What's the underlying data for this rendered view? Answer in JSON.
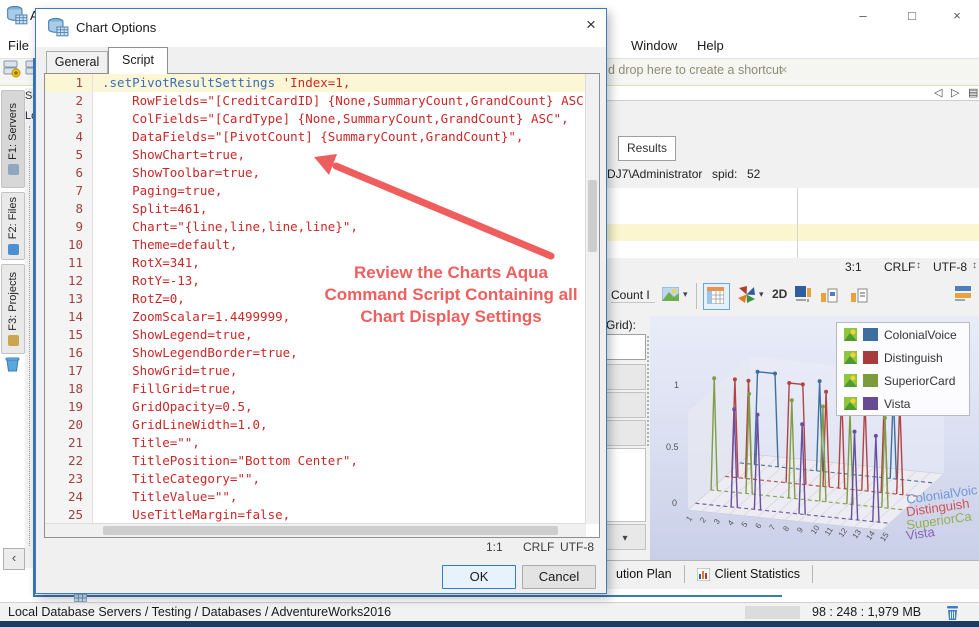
{
  "glyphs": {
    "close": "×",
    "minimize": "–",
    "maximize": "□",
    "caret": "▾",
    "back": "◁",
    "forward": "▷",
    "list": "▤",
    "updown": "↕",
    "collapse": "‹"
  },
  "window": {
    "title_partial": "A",
    "menus": {
      "file": "File",
      "window": "Window",
      "help": "Help"
    },
    "shortcut_hint": "d drop here to create a shortcut",
    "sidebar_tabs": [
      {
        "label": "F1: Servers"
      },
      {
        "label": "F2: Files"
      },
      {
        "label": "F3: Projects"
      }
    ],
    "servers_panel": {
      "header_partial": "Se",
      "tree_item_partial": "Lo"
    },
    "status": {
      "breadcrumb": "Local Database Servers / Testing / Databases / AdventureWorks2016",
      "memory": "98 : 248 : 1,979 MB"
    }
  },
  "dialog": {
    "title": "Chart Options",
    "tabs": {
      "general": "General",
      "script": "Script"
    },
    "code_lines": [
      {
        "num": "1",
        "kw": ".setPivotResultSettings",
        "text": " 'Index=1,",
        "current": true
      },
      {
        "num": "2",
        "kw": "",
        "text": "    RowFields=\"[CreditCardID] {None,SummaryCount,GrandCount} ASC\","
      },
      {
        "num": "3",
        "kw": "",
        "text": "    ColFields=\"[CardType] {None,SummaryCount,GrandCount} ASC\","
      },
      {
        "num": "4",
        "kw": "",
        "text": "    DataFields=\"[PivotCount] {SummaryCount,GrandCount}\","
      },
      {
        "num": "5",
        "kw": "",
        "text": "    ShowChart=true,"
      },
      {
        "num": "6",
        "kw": "",
        "text": "    ShowToolbar=true,"
      },
      {
        "num": "7",
        "kw": "",
        "text": "    Paging=true,"
      },
      {
        "num": "8",
        "kw": "",
        "text": "    Split=461,"
      },
      {
        "num": "9",
        "kw": "",
        "text": "    Chart=\"{line,line,line,line}\","
      },
      {
        "num": "10",
        "kw": "",
        "text": "    Theme=default,"
      },
      {
        "num": "11",
        "kw": "",
        "text": "    RotX=341,"
      },
      {
        "num": "12",
        "kw": "",
        "text": "    RotY=-13,"
      },
      {
        "num": "13",
        "kw": "",
        "text": "    RotZ=0,"
      },
      {
        "num": "14",
        "kw": "",
        "text": "    ZoomScalar=1.4499999,"
      },
      {
        "num": "15",
        "kw": "",
        "text": "    ShowLegend=true,"
      },
      {
        "num": "16",
        "kw": "",
        "text": "    ShowLegendBorder=true,"
      },
      {
        "num": "17",
        "kw": "",
        "text": "    ShowGrid=true,"
      },
      {
        "num": "18",
        "kw": "",
        "text": "    FillGrid=true,"
      },
      {
        "num": "19",
        "kw": "",
        "text": "    GridOpacity=0.5,"
      },
      {
        "num": "20",
        "kw": "",
        "text": "    GridLineWidth=1.0,"
      },
      {
        "num": "21",
        "kw": "",
        "text": "    Title=\"\","
      },
      {
        "num": "22",
        "kw": "",
        "text": "    TitlePosition=\"Bottom Center\","
      },
      {
        "num": "23",
        "kw": "",
        "text": "    TitleCategory=\"\","
      },
      {
        "num": "24",
        "kw": "",
        "text": "    TitleValue=\"\","
      },
      {
        "num": "25",
        "kw": "",
        "text": "    UseTitleMargin=false,"
      }
    ],
    "status": {
      "caret": "1:1",
      "eol": "CRLF",
      "encoding": "UTF-8"
    },
    "buttons": {
      "ok": "OK",
      "cancel": "Cancel"
    },
    "annotation": [
      "Review the Charts Aqua",
      "Command Script Containing all",
      "Chart Display Settings"
    ]
  },
  "results": {
    "tab": "Results",
    "user": "DJ7\\Administrator",
    "spid_label": "spid:",
    "spid_value": "52",
    "status": {
      "caret": "3:1",
      "eol": "CRLF",
      "encoding": "UTF-8"
    },
    "toolbar": {
      "count_partial": "Count I",
      "mode": "2D"
    },
    "grid_label_partial": "Grid):",
    "bottom_tabs": [
      {
        "label": "ution Plan"
      },
      {
        "label": "Client Statistics"
      }
    ]
  },
  "chart": {
    "legend": [
      {
        "label": "ColonialVoice",
        "color": "#3d6e9e"
      },
      {
        "label": "Distinguish",
        "color": "#a83c3c"
      },
      {
        "label": "SuperiorCard",
        "color": "#7d9a3c"
      },
      {
        "label": "Vista",
        "color": "#664a92"
      }
    ],
    "axis_series_labels": [
      {
        "label": "ColonialVoic",
        "color": "#6f97d6"
      },
      {
        "label": "Distinguish",
        "color": "#d05050"
      },
      {
        "label": "SuperiorCa",
        "color": "#93b24e"
      },
      {
        "label": "Vista",
        "color": "#8563b8"
      }
    ],
    "y_ticks": [
      "1",
      "0.5",
      "0"
    ],
    "x_ticks": [
      "1",
      "2",
      "3",
      "4",
      "5",
      "6",
      "7",
      "8",
      "9",
      "10",
      "11",
      "12",
      "13",
      "14",
      "15"
    ]
  }
}
